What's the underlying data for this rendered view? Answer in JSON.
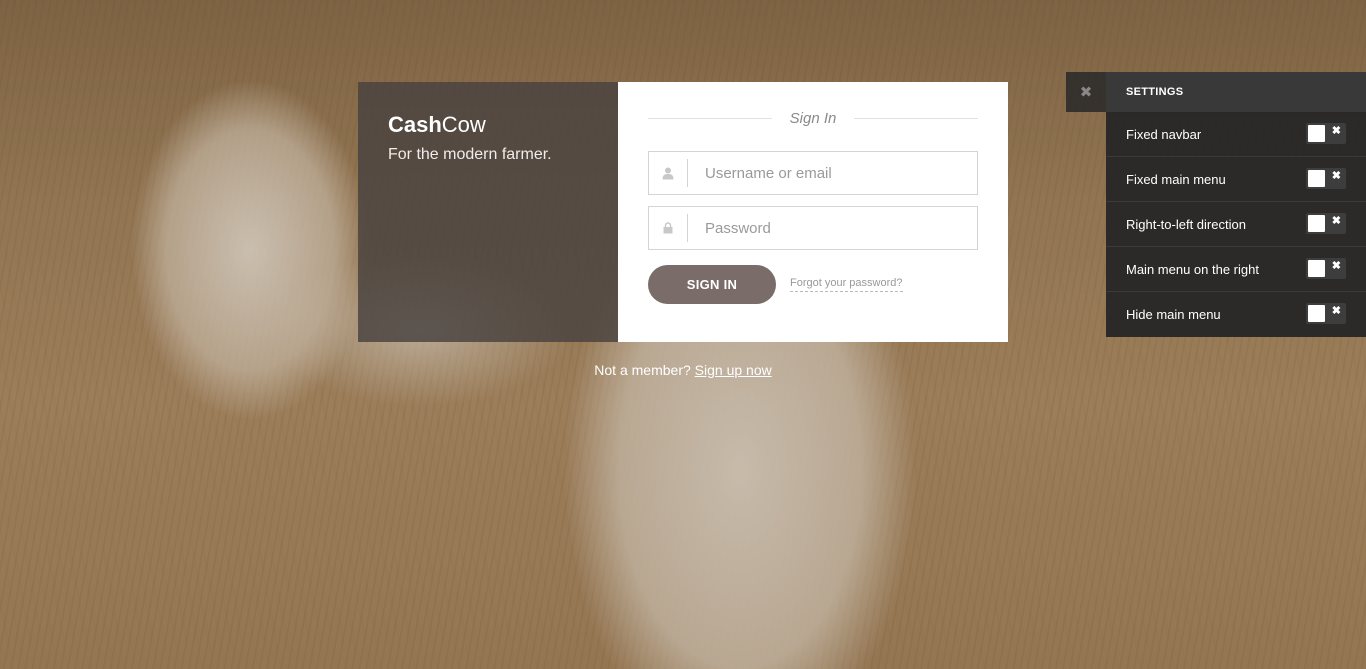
{
  "brand": {
    "name_bold": "Cash",
    "name_regular": "Cow",
    "tagline": "For the modern farmer."
  },
  "signin": {
    "heading": "Sign In",
    "username_placeholder": "Username or email",
    "password_placeholder": "Password",
    "button_label": "SIGN IN",
    "forgot_label": "Forgot your password?"
  },
  "signup": {
    "prompt": "Not a member?",
    "link_label": "Sign up now"
  },
  "settings": {
    "title": "SETTINGS",
    "close_icon": "close-icon",
    "items": [
      {
        "label": "Fixed navbar",
        "enabled": false
      },
      {
        "label": "Fixed main menu",
        "enabled": false
      },
      {
        "label": "Right-to-left direction",
        "enabled": false
      },
      {
        "label": "Main menu on the right",
        "enabled": false
      },
      {
        "label": "Hide main menu",
        "enabled": false
      }
    ]
  },
  "colors": {
    "brand_panel": "#4a4240",
    "signin_button": "#7a6c68",
    "settings_panel": "#262626"
  }
}
